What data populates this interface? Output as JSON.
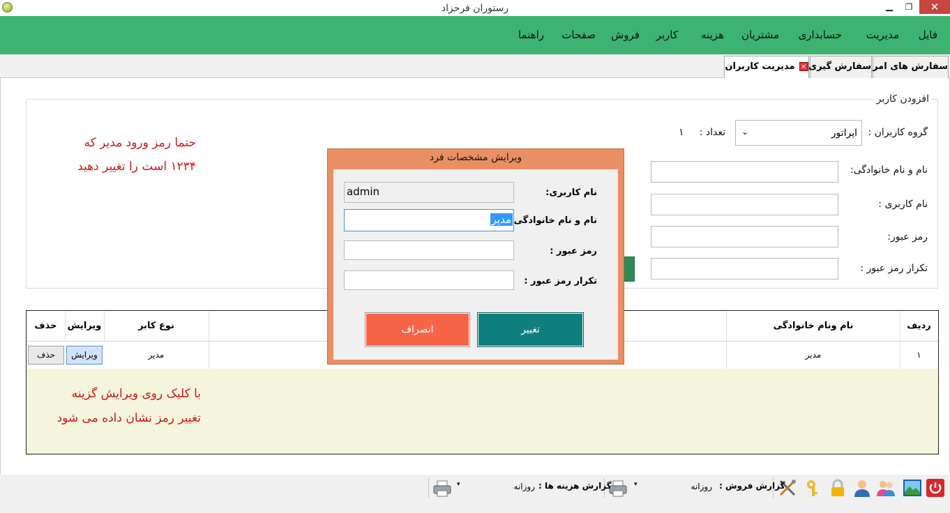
{
  "window": {
    "title": "رستوران فرحزاد",
    "minimize": "▁",
    "maximize": "❐",
    "close": "✕"
  },
  "menu": [
    "فایل",
    "مدیریت",
    "حسابداری",
    "مشتریان",
    "هزینه",
    "کاربر",
    "فروش",
    "صفحات",
    "راهنما"
  ],
  "tabs": {
    "today_orders": "سفارش های امروز",
    "order_taking": "سفارش گیری",
    "user_management": "مدیریت کاربران",
    "close_glyph": "✕"
  },
  "add_user": {
    "legend": "افزودن کاربر",
    "group_label": "گروه کاربران :",
    "group_value": "اپراتور",
    "group_arrow": "⌄",
    "count_label": "تعداد :",
    "count_value": "۱",
    "fullname_label": "نام و نام خانوادگی:",
    "username_label": "نام کاربری :",
    "password_label": "رمز عبور:",
    "confirm_label": "تکرار رمز عبور :"
  },
  "hints": {
    "top_line1": "حتما رمز ورود مدیر که",
    "top_line2": "۱۲۳۴ است را تغییر دهید",
    "bottom_line1": "با کلیک روی ویرایش گزینه",
    "bottom_line2": "تغییر رمز نشان داده می شود"
  },
  "grid": {
    "headers": {
      "row": "ردیف",
      "fullname": "نام ونام خانوادگی",
      "type": "نوع کابر",
      "edit": "ویرایش",
      "delete": "حذف"
    },
    "rows": [
      {
        "row": "۱",
        "fullname": "مدیر",
        "type": "مدیر",
        "edit": "ویرایش",
        "delete": "حذف"
      }
    ]
  },
  "dialog": {
    "title": "ویرایش مشخصات فرد",
    "username_label": "نام کاربری:",
    "username_value": "admin",
    "fullname_label": "نام و نام خانوادگی :",
    "fullname_value": "مدیر",
    "password_label": "رمز عبور :",
    "confirm_label": "تکرار رمز عبور :",
    "change_button": "تغییر",
    "cancel_button": "انصراف"
  },
  "statusbar": {
    "sales_report_label": "گزارش فروش :",
    "sales_report_value": "روزانه",
    "expense_report_label": "گزارش هزینه ها :",
    "expense_report_value": "روزانه",
    "combo_arrow": "▾",
    "icons": [
      "power-icon",
      "landscape-icon",
      "users-icon",
      "user-icon",
      "lock-icon",
      "key-icon",
      "tools-icon",
      "printer-icon"
    ]
  },
  "colors": {
    "menubar": "#3cb371",
    "dialog_frame": "#ea8f63",
    "change_button": "#0f7f7d",
    "cancel_button": "#f76549",
    "hint_text": "#d01818",
    "grid_background": "#f5f4dd"
  }
}
